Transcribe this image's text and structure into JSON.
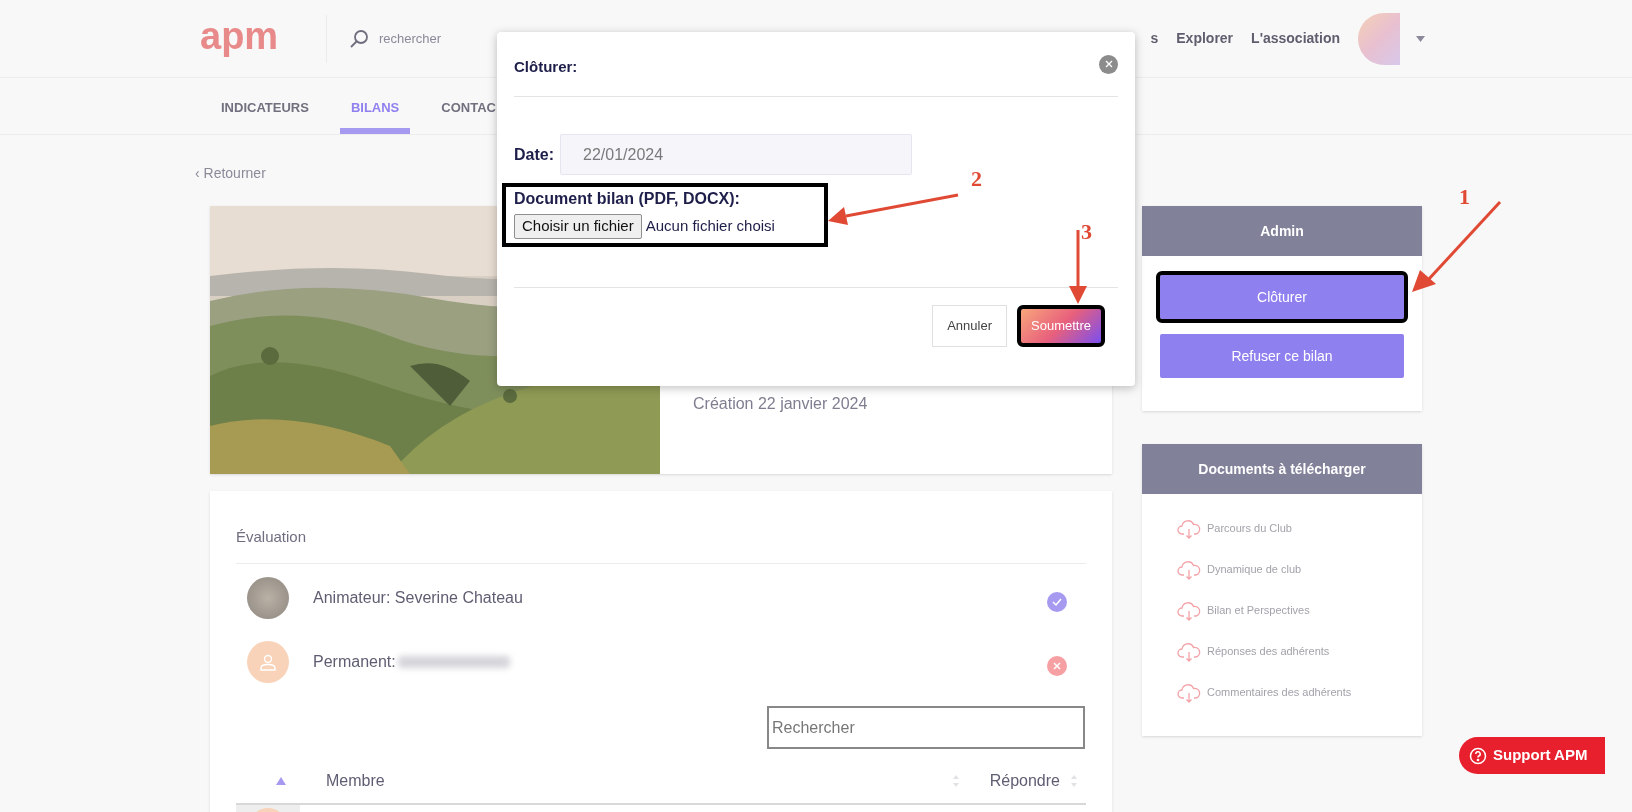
{
  "header": {
    "logo": "apm",
    "search_placeholder": "rechercher",
    "nav": [
      "s",
      "Explorer",
      "L'association"
    ]
  },
  "tabs": [
    {
      "label": "INDICATEURS",
      "selected": false
    },
    {
      "label": "BILANS",
      "selected": true
    },
    {
      "label": "CONTAC",
      "selected": false
    }
  ],
  "back_link": "‹ Retourner",
  "bilan": {
    "created": "Création 22 janvier 2024"
  },
  "evaluation": {
    "title": "Évaluation",
    "rows": [
      {
        "label": "Animateur: Severine Chateau",
        "approved": true,
        "redacted": false
      },
      {
        "label": "Permanent:",
        "kind": "placeholder",
        "approved": false,
        "redacted": true
      }
    ],
    "search_placeholder": "Rechercher",
    "columns": [
      {
        "label": "Membre",
        "sorted": true
      },
      {
        "label": "Répondre",
        "sorted": false
      }
    ]
  },
  "admin": {
    "title": "Admin",
    "buttons": [
      {
        "label": "Clôturer",
        "highlighted": true
      },
      {
        "label": "Refuser ce bilan",
        "highlighted": false
      }
    ]
  },
  "documents": {
    "title": "Documents à télécharger",
    "items": [
      "Parcours du Club",
      "Dynamique de club",
      "Bilan et Perspectives",
      "Réponses des adhérents",
      "Commentaires des adhérents"
    ]
  },
  "modal": {
    "title": "Clôturer:",
    "date_label": "Date:",
    "date_value": "22/01/2024",
    "file_label": "Document bilan (PDF, DOCX):",
    "file_button": "Choisir un fichier",
    "file_status": "Aucun fichier choisi",
    "cancel": "Annuler",
    "submit": "Soumettre"
  },
  "annotations": [
    {
      "number": "1"
    },
    {
      "number": "2"
    },
    {
      "number": "3"
    }
  ],
  "support_button": "Support APM"
}
